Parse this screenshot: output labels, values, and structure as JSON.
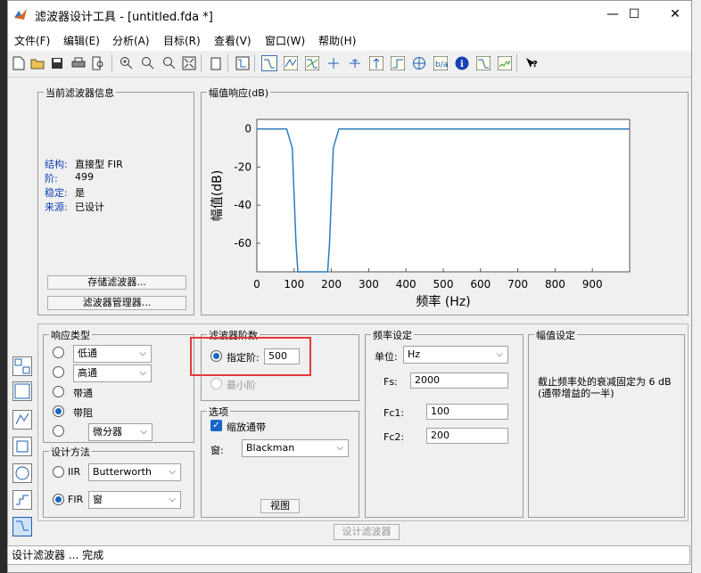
{
  "window": {
    "title": "滤波器设计工具 -  [untitled.fda *]",
    "minimize_glyph": "—",
    "maximize_glyph": "☐",
    "close_glyph": "✕"
  },
  "menubar": {
    "items": [
      "文件(F)",
      "编辑(E)",
      "分析(A)",
      "目标(R)",
      "查看(V)",
      "窗口(W)",
      "帮助(H)"
    ]
  },
  "filter_info": {
    "title": "当前滤波器信息",
    "rows": [
      {
        "key": "结构:",
        "value": "直接型 FIR"
      },
      {
        "key": "阶:",
        "value": "499"
      },
      {
        "key": "稳定:",
        "value": "是"
      },
      {
        "key": "来源:",
        "value": "已设计"
      }
    ],
    "store_button": "存储滤波器...",
    "manager_button": "滤波器管理器..."
  },
  "magnitude_panel": {
    "title": "幅值响应(dB)"
  },
  "chart_data": {
    "type": "line",
    "xlabel": "频率 (Hz)",
    "ylabel": "幅值(dB)",
    "xlim": [
      0,
      1000
    ],
    "ylim": [
      -75,
      5
    ],
    "xticks": [
      0,
      100,
      200,
      300,
      400,
      500,
      600,
      700,
      800,
      900
    ],
    "yticks": [
      0,
      -20,
      -40,
      -60
    ],
    "grid": false,
    "series": [
      {
        "x": [
          0,
          80,
          95,
          105,
          110,
          190,
          195,
          205,
          220,
          1000
        ],
        "y": [
          0,
          0,
          -10,
          -60,
          -75,
          -75,
          -60,
          -10,
          0,
          0
        ]
      }
    ],
    "line_color": "#2f7bbf"
  },
  "response_type": {
    "title": "响应类型",
    "options": [
      {
        "label": "低通",
        "type": "select",
        "selected": false
      },
      {
        "label": "高通",
        "type": "select",
        "selected": false
      },
      {
        "label": "带通",
        "type": "plain",
        "selected": false
      },
      {
        "label": "带阻",
        "type": "plain",
        "selected": true
      },
      {
        "label": "微分器",
        "type": "select",
        "selected": false
      }
    ]
  },
  "design_method": {
    "title": "设计方法",
    "iir_label": "IIR",
    "iir_value": "Butterworth",
    "fir_label": "FIR",
    "fir_value": "窗"
  },
  "filter_order": {
    "title": "滤波器阶数",
    "specify_label": "指定阶:",
    "specify_value": "500",
    "minimum_label": "最小阶"
  },
  "options": {
    "title": "选项",
    "scale_passband_label": "缩放通带",
    "window_label": "窗:",
    "window_value": "Blackman",
    "view_button": "视图"
  },
  "frequency_spec": {
    "title": "频率设定",
    "unit_label": "单位:",
    "unit_value": "Hz",
    "fs_label": "Fs:",
    "fs_value": "2000",
    "fc1_label": "Fc1:",
    "fc1_value": "100",
    "fc2_label": "Fc2:",
    "fc2_value": "200"
  },
  "magnitude_spec": {
    "title": "幅值设定",
    "note": "截止频率处的衰减固定为 6 dB\n(通带增益的一半)"
  },
  "design_button": "设计滤波器",
  "status": "设计滤波器 ... 完成"
}
